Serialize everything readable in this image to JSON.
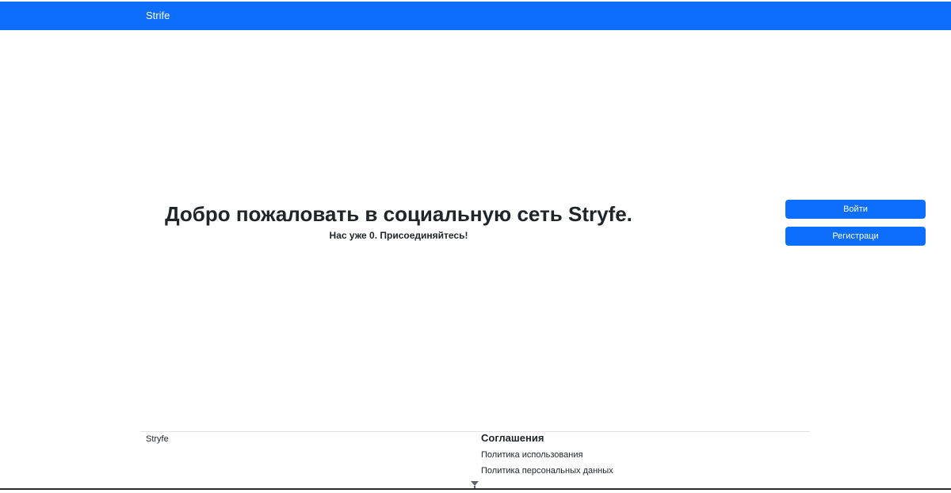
{
  "navbar": {
    "brand": "Strife",
    "background": "#0d6efd"
  },
  "hero": {
    "title": "Добро пожаловать в социальную сеть Stryfe.",
    "subtitle": "Нас уже 0. Присоединяйтесь!"
  },
  "actions": {
    "login_label": "Войти",
    "register_label": "Регистраци"
  },
  "footer": {
    "brand": "Stryfe",
    "agreements_heading": "Соглашения",
    "links": [
      {
        "label": "Политика использования"
      },
      {
        "label": "Политика персональных данных"
      }
    ]
  },
  "icons": {
    "scroll": "chevron-down-icon"
  }
}
